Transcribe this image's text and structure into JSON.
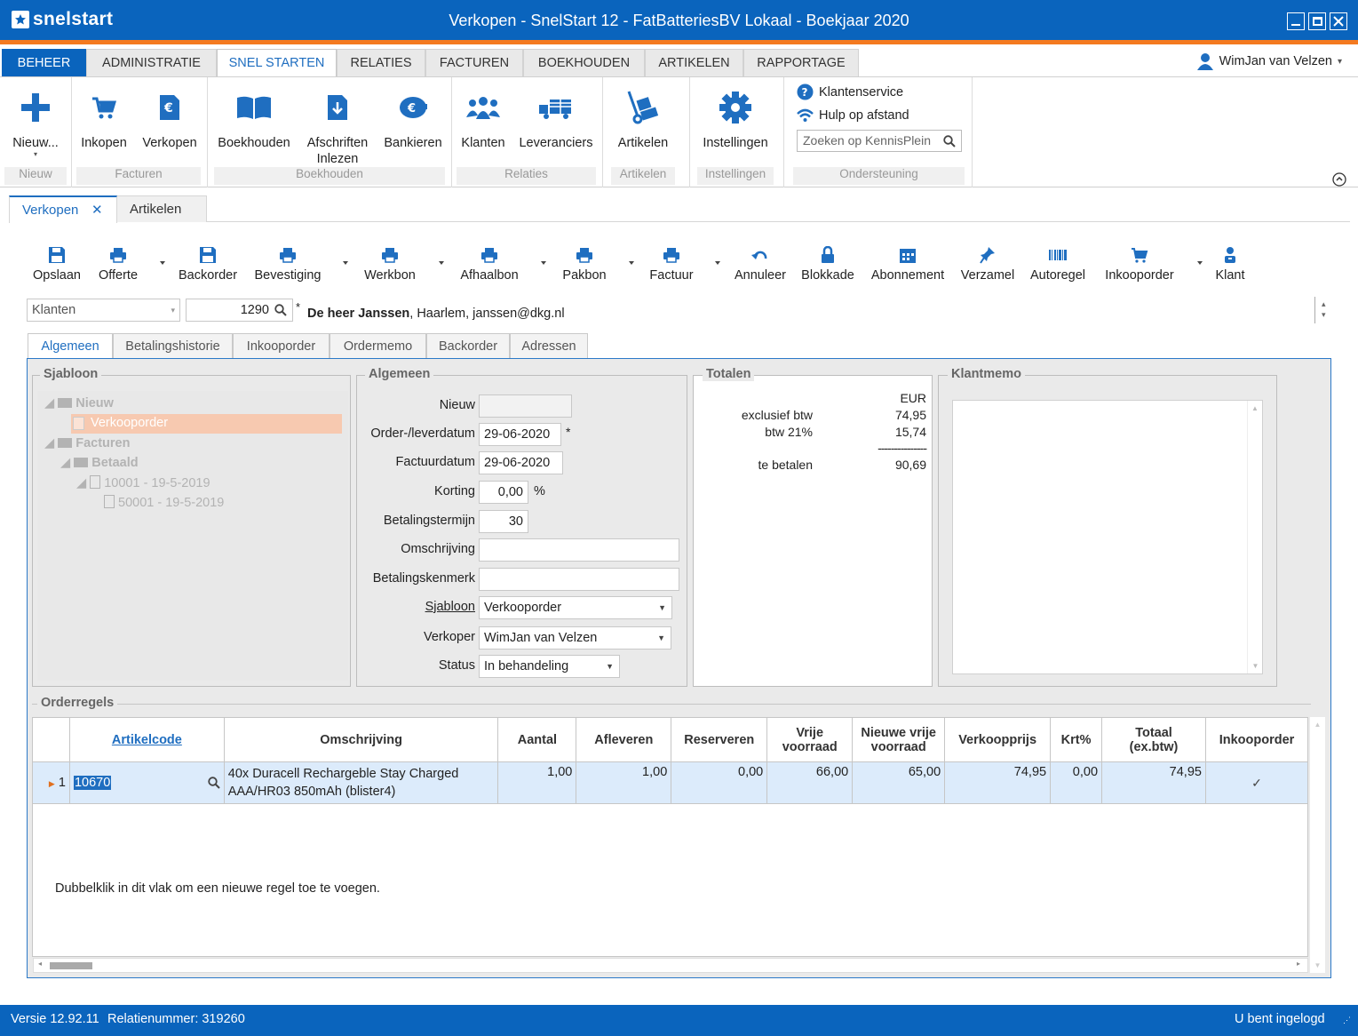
{
  "window": {
    "logo_text": "snelstart",
    "title": "Verkopen - SnelStart 12 - FatBatteriesBV Lokaal - Boekjaar 2020"
  },
  "menu": {
    "tabs": [
      {
        "label": "BEHEER"
      },
      {
        "label": "ADMINISTRATIE"
      },
      {
        "label": "SNEL STARTEN"
      },
      {
        "label": "RELATIES"
      },
      {
        "label": "FACTUREN"
      },
      {
        "label": "BOEKHOUDEN"
      },
      {
        "label": "ARTIKELEN"
      },
      {
        "label": "RAPPORTAGE"
      }
    ],
    "user": "WimJan van Velzen"
  },
  "ribbon": {
    "nieuw": "Nieuw...",
    "inkopen": "Inkopen",
    "verkopen": "Verkopen",
    "boekhouden": "Boekhouden",
    "afschriften": "Afschriften",
    "inlezen": "Inlezen",
    "bankieren": "Bankieren",
    "klanten": "Klanten",
    "leveranciers": "Leveranciers",
    "artikelen": "Artikelen",
    "instellingen": "Instellingen",
    "groups": {
      "nieuw": "Nieuw",
      "facturen": "Facturen",
      "boekhouden": "Boekhouden",
      "relaties": "Relaties",
      "artikelen": "Artikelen",
      "instellingen": "Instellingen",
      "ondersteuning": "Ondersteuning"
    },
    "klantenservice": "Klantenservice",
    "hulp": "Hulp op afstand",
    "search_placeholder": "Zoeken op KennisPlein"
  },
  "doc_tabs": {
    "verkopen": "Verkopen",
    "artikelen": "Artikelen"
  },
  "toolbar": {
    "opslaan": "Opslaan",
    "offerte": "Offerte",
    "backorder": "Backorder",
    "bevestiging": "Bevestiging",
    "werkbon": "Werkbon",
    "afhaalbon": "Afhaalbon",
    "pakbon": "Pakbon",
    "factuur": "Factuur",
    "annuleer": "Annuleer",
    "blokkade": "Blokkade",
    "abonnement": "Abonnement",
    "verzamel": "Verzamel",
    "autoregel": "Autoregel",
    "inkooporder": "Inkooporder",
    "klant": "Klant"
  },
  "customer": {
    "type": "Klanten",
    "number": "1290",
    "name": "De heer Janssen",
    "details": ", Haarlem, janssen@dkg.nl"
  },
  "form_tabs": {
    "algemeen": "Algemeen",
    "betalingshistorie": "Betalingshistorie",
    "inkooporder": "Inkooporder",
    "ordermemo": "Ordermemo",
    "backorder": "Backorder",
    "adressen": "Adressen"
  },
  "sjabloon": {
    "title": "Sjabloon",
    "nieuw": "Nieuw",
    "verkooporder": "Verkooporder",
    "facturen": "Facturen",
    "betaald": "Betaald",
    "f1": "10001 - 19-5-2019",
    "f2": "50001 - 19-5-2019"
  },
  "algemeen": {
    "title": "Algemeen",
    "nieuw_lbl": "Nieuw",
    "orderdatum_lbl": "Order-/leverdatum",
    "orderdatum": "29-06-2020",
    "factuurdatum_lbl": "Factuurdatum",
    "factuurdatum": "29-06-2020",
    "korting_lbl": "Korting",
    "korting": "0,00",
    "pct": "%",
    "termijn_lbl": "Betalingstermijn",
    "termijn": "30",
    "omschrijving_lbl": "Omschrijving",
    "kenmerk_lbl": "Betalingskenmerk",
    "sjabloon_lbl": "Sjabloon",
    "sjabloon": "Verkooporder",
    "verkoper_lbl": "Verkoper",
    "verkoper": "WimJan van Velzen",
    "status_lbl": "Status",
    "status": "In behandeling"
  },
  "totalen": {
    "title": "Totalen",
    "currency": "EUR",
    "excl_lbl": "exclusief btw",
    "excl": "74,95",
    "btw_lbl": "btw 21%",
    "btw": "15,74",
    "dashes": "---------------",
    "te_betalen_lbl": "te betalen",
    "te_betalen": "90,69"
  },
  "klantmemo": {
    "title": "Klantmemo"
  },
  "orderregels": {
    "title": "Orderregels",
    "columns": [
      "Artikelcode",
      "Omschrijving",
      "Aantal",
      "Afleveren",
      "Reserveren",
      "Vrije voorraad",
      "Nieuwe vrije voorraad",
      "Verkoopprijs",
      "Krt%",
      "Totaal (ex.btw)",
      "Inkooporder"
    ],
    "rows": [
      {
        "nr": "1",
        "code": "10670",
        "omschrijving1": "40x Duracell Rechargeble Stay Charged",
        "omschrijving2": "AAA/HR03 850mAh (blister4)",
        "aantal": "1,00",
        "afleveren": "1,00",
        "reserveren": "0,00",
        "vrij": "66,00",
        "nieuw_vrij": "65,00",
        "prijs": "74,95",
        "krt": "0,00",
        "totaal": "74,95",
        "inkooporder_checked": true
      }
    ],
    "hint": "Dubbelklik in dit vlak om een nieuwe regel toe te voegen."
  },
  "status": {
    "version": "Versie 12.92.11",
    "relatie": "Relatienummer: 319260",
    "login": "U bent ingelogd"
  },
  "colors": {
    "accent": "#0a64bd",
    "orange": "#f47a20",
    "selection": "#f7c9b0",
    "row": "#dcebfb"
  }
}
